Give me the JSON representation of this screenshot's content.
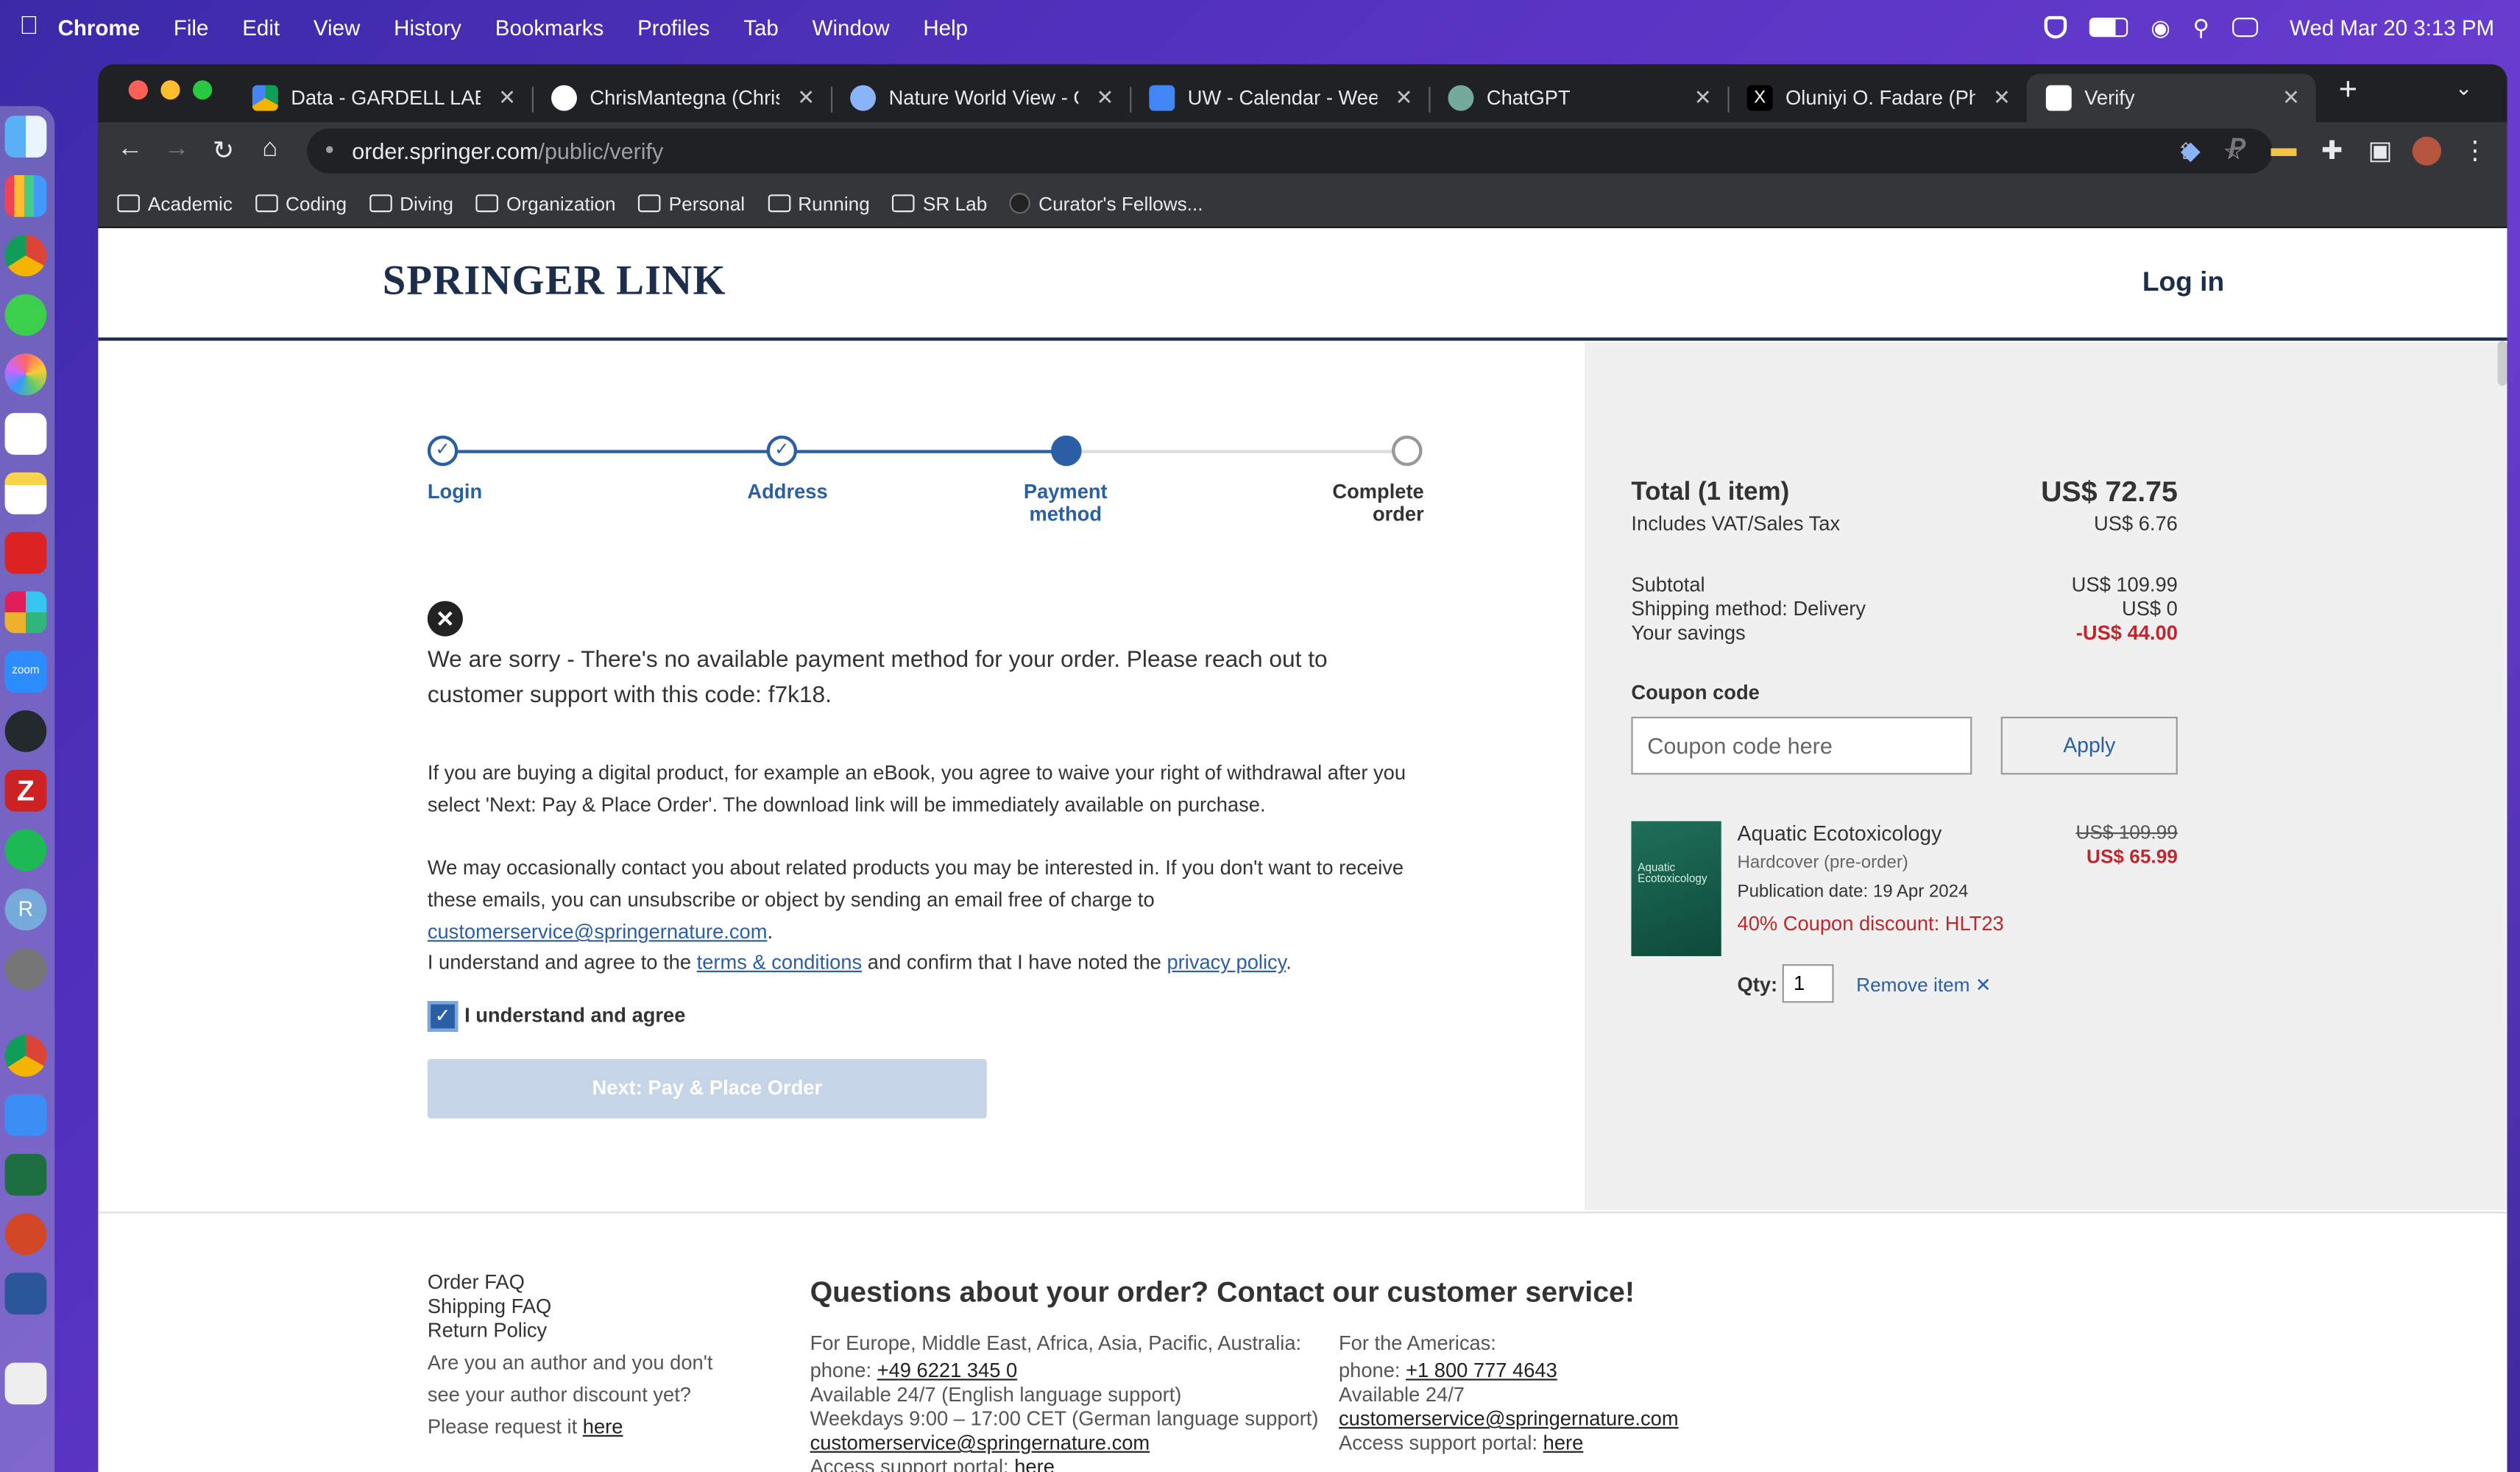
{
  "menubar": {
    "app": "Chrome",
    "items": [
      "File",
      "Edit",
      "View",
      "History",
      "Bookmarks",
      "Profiles",
      "Tab",
      "Window",
      "Help"
    ],
    "datetime": "Wed Mar 20  3:13 PM"
  },
  "browser": {
    "tabs": [
      {
        "title": "Data - GARDELL LAB - G"
      },
      {
        "title": "ChrisMantegna (Chris M"
      },
      {
        "title": "Nature World View - Go"
      },
      {
        "title": "UW - Calendar - Week o"
      },
      {
        "title": "ChatGPT"
      },
      {
        "title": "Oluniyi O. Fadare (Ph.D"
      },
      {
        "title": "Verify"
      }
    ],
    "url_host": "order.springer.com",
    "url_path": "/public/verify",
    "bookmarks": [
      "Academic",
      "Coding",
      "Diving",
      "Organization",
      "Personal",
      "Running",
      "SR Lab",
      "Curator's Fellows..."
    ]
  },
  "header": {
    "logo": "SPRINGER LINK",
    "login": "Log in"
  },
  "steps": [
    {
      "label": "Login",
      "state": "done"
    },
    {
      "label": "Address",
      "state": "done"
    },
    {
      "label": "Payment method",
      "state": "current"
    },
    {
      "label": "Complete order",
      "state": "todo"
    }
  ],
  "main": {
    "error_message": "We are sorry - There's no available payment method for your order. Please reach out to customer support with this code: f7k18.",
    "withdrawal_text": "If you are buying a digital product, for example an eBook, you agree to waive your right of withdrawal after you select 'Next: Pay & Place Order'. The download link will be immediately available on purchase.",
    "contact_text_1": "We may occasionally contact you about related products you may be interested in. If you don't want to receive these emails, you can unsubscribe or object by sending an email free of charge to",
    "contact_email": "customerservice@springernature.com",
    "terms_pre": "I understand and agree to the",
    "terms_link": "terms & conditions",
    "terms_mid": "and confirm that I have noted the",
    "privacy_link": "privacy policy",
    "agree_label": "I understand and agree",
    "next_button": "Next: Pay & Place Order"
  },
  "summary": {
    "total_label": "Total (1 item)",
    "total_value": "US$ 72.75",
    "vat_label": "Includes VAT/Sales Tax",
    "vat_value": "US$ 6.76",
    "subtotal_label": "Subtotal",
    "subtotal_value": "US$ 109.99",
    "shipping_label": "Shipping method: Delivery",
    "shipping_value": "US$ 0",
    "savings_label": "Your savings",
    "savings_value": "-US$ 44.00",
    "coupon_label": "Coupon code",
    "coupon_placeholder": "Coupon code here",
    "apply_button": "Apply",
    "item": {
      "title": "Aquatic Ecotoxicology",
      "format": "Hardcover (pre-order)",
      "pubdate": "Publication date: 19 Apr 2024",
      "discount": "40% Coupon discount: HLT23",
      "old_price": "US$ 109.99",
      "new_price": "US$ 65.99",
      "qty_label": "Qty:",
      "qty_value": "1",
      "remove": "Remove item",
      "cover_text": "Aquatic Ecotoxicology"
    }
  },
  "footer": {
    "links": [
      "Order FAQ",
      "Shipping FAQ",
      "Return Policy"
    ],
    "author_text": "Are you an author and you don't see your author discount yet? Please request it",
    "author_link": "here",
    "heading": "Questions about your order? Contact our customer service!",
    "eu": {
      "region": "For Europe, Middle East, Africa, Asia, Pacific, Australia:",
      "phone_label": "phone:",
      "phone": "+49 6221 345 0",
      "avail1": "Available 24/7 (English language support)",
      "avail2": "Weekdays 9:00 – 17:00 CET (German language support)",
      "email": "customerservice@springernature.com",
      "portal_label": "Access support portal:",
      "portal_link": "here"
    },
    "us": {
      "region": "For the Americas:",
      "phone_label": "phone:",
      "phone": "+1 800 777 4643",
      "avail": "Available 24/7",
      "email": "customerservice@springernature.com",
      "portal_label": "Access support portal:",
      "portal_link": "here"
    }
  }
}
